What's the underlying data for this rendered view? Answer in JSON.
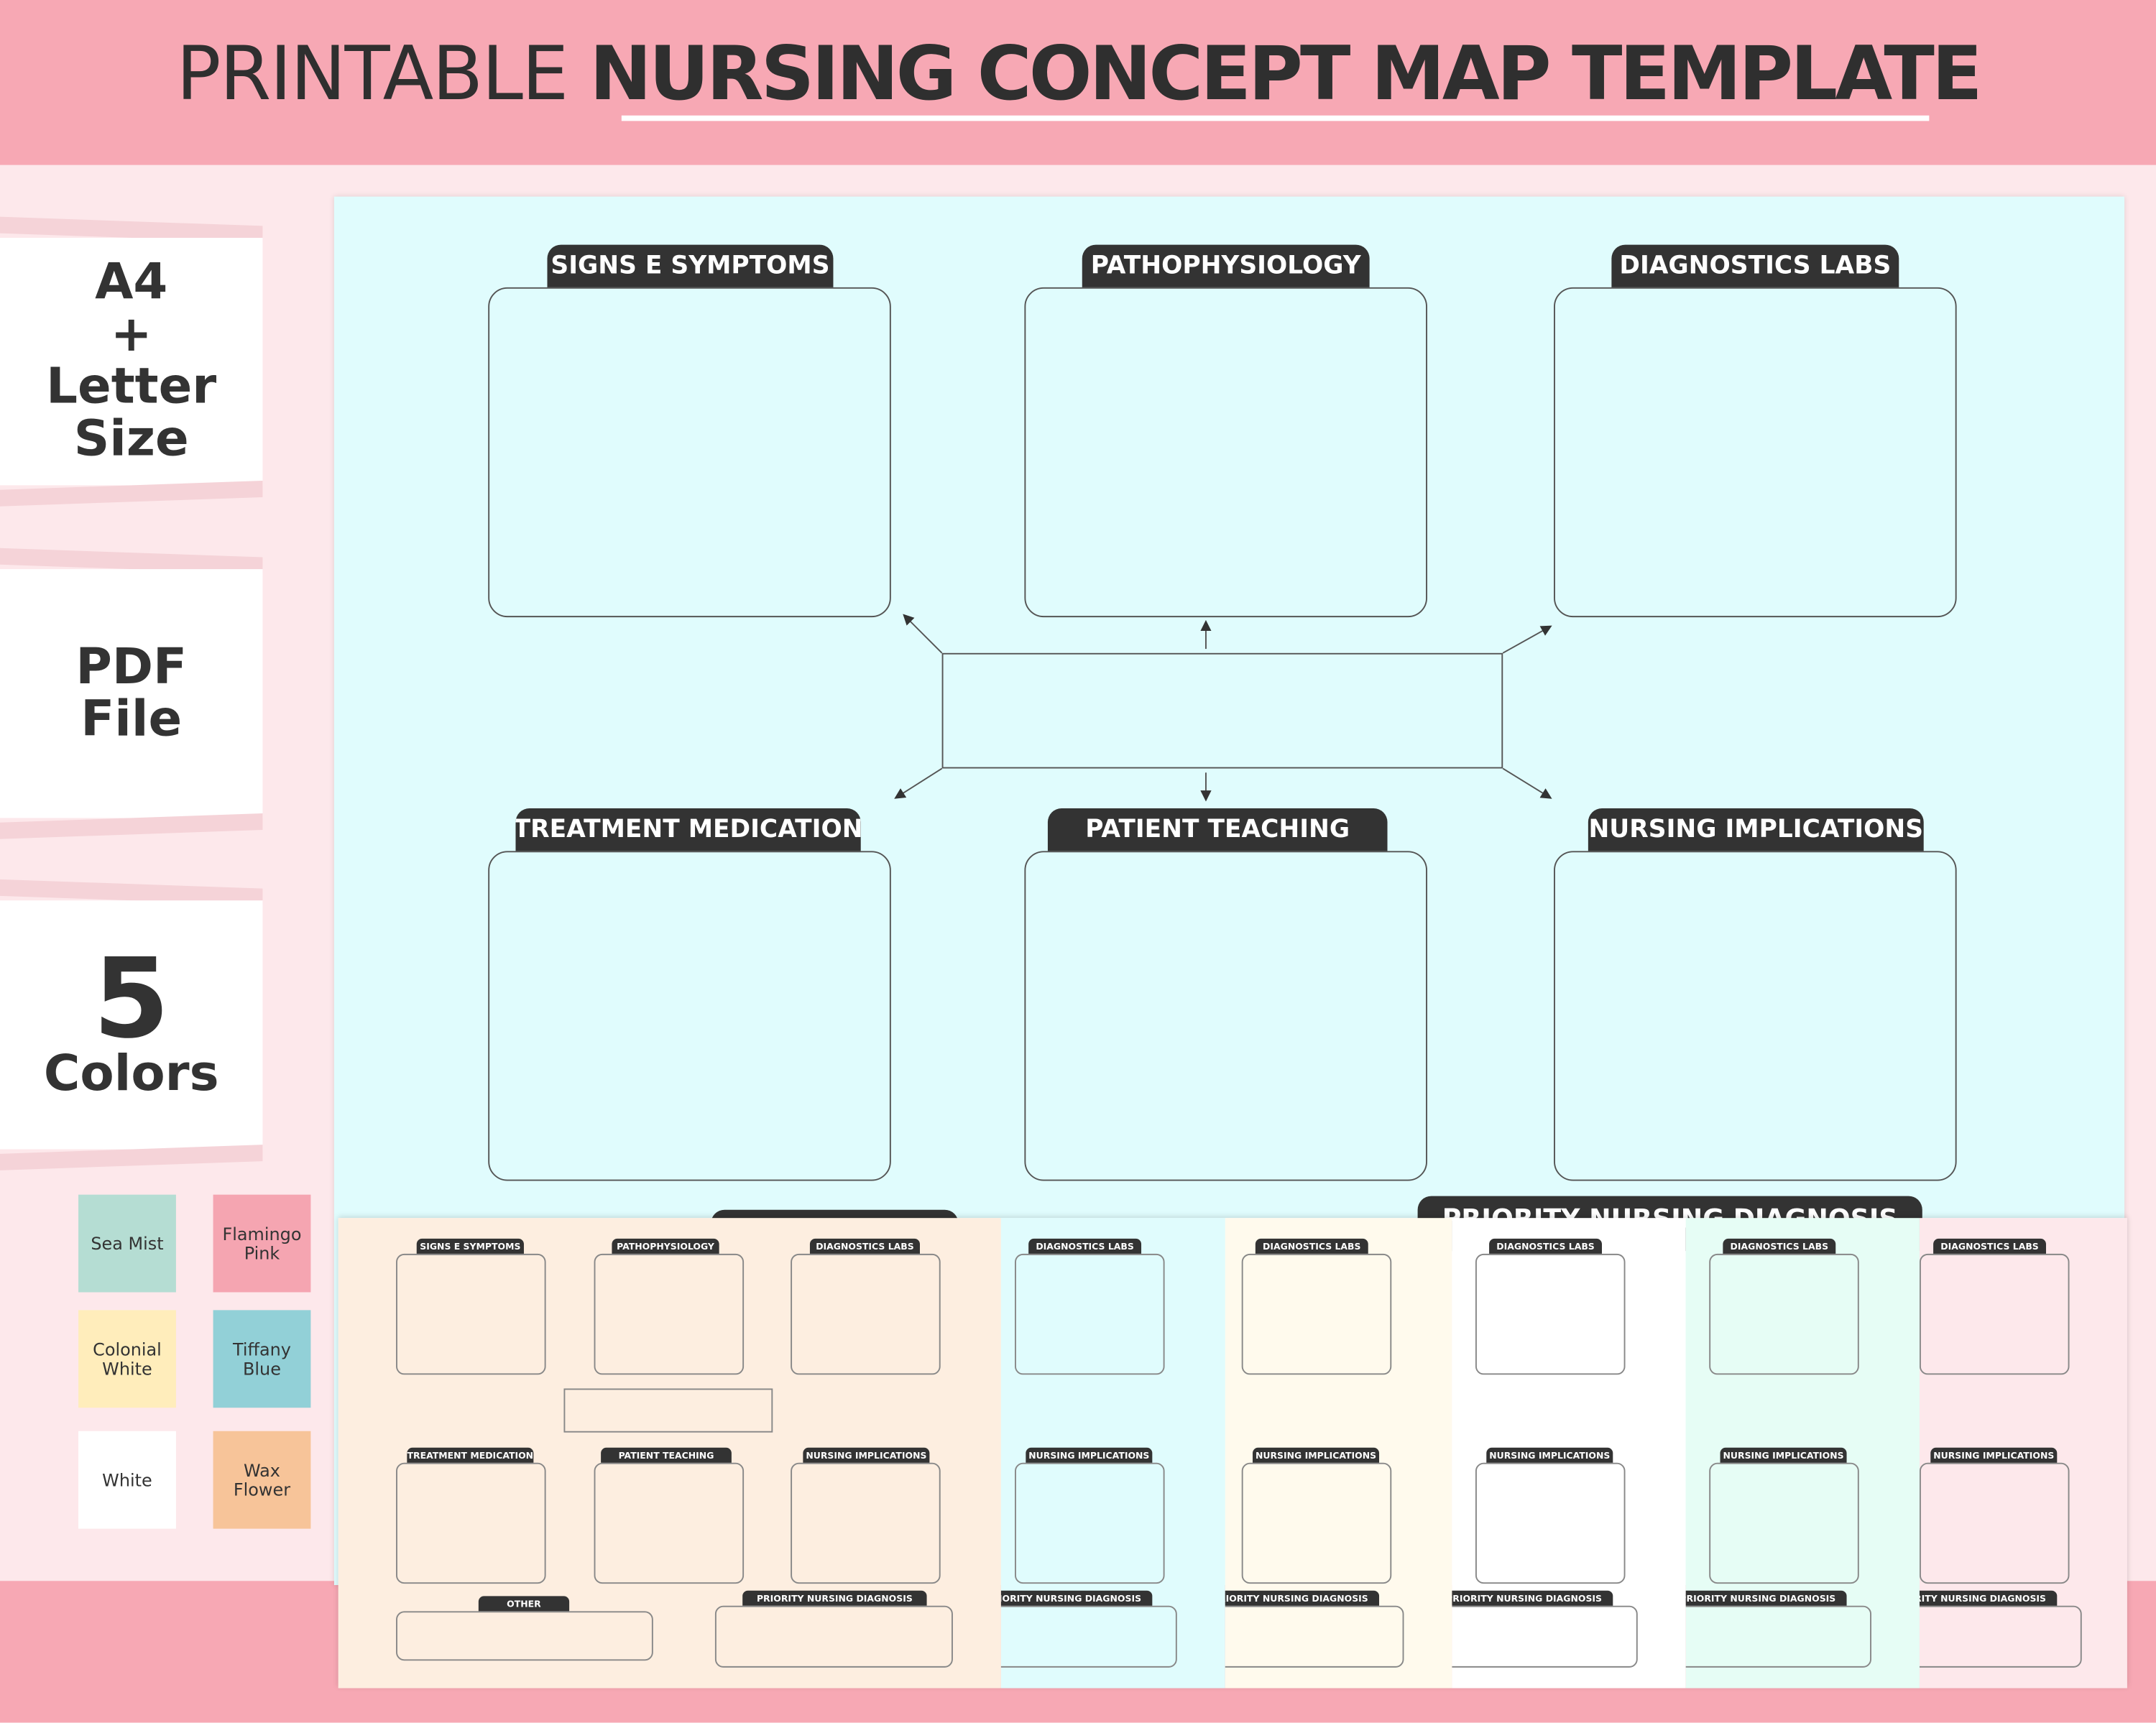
{
  "header": {
    "title_light": "PRINTABLE",
    "title_bold": "NURSING CONCEPT MAP TEMPLATE"
  },
  "features": [
    {
      "lines": [
        "A4",
        "+",
        "Letter",
        "Size"
      ]
    },
    {
      "lines": [
        "PDF",
        "File"
      ]
    },
    {
      "lines": [
        "5",
        "Colors"
      ]
    }
  ],
  "template": {
    "sections": [
      "SIGNS E SYMPTOMS",
      "PATHOPHYSIOLOGY",
      "DIAGNOSTICS LABS",
      "TREATMENT MEDICATION",
      "PATIENT TEACHING",
      "NURSING IMPLICATIONS"
    ],
    "other": "OTHER",
    "priority": "PRIORITY NURSING DIAGNOSIS",
    "background": "#e0fcfd"
  },
  "mini": {
    "sections": [
      "SIGNS E SYMPTOMS",
      "PATHOPHYSIOLOGY",
      "DIAGNOSTICS LABS",
      "TREATMENT MEDICATION",
      "PATIENT TEACHING",
      "NURSING IMPLICATIONS"
    ],
    "other": "OTHER",
    "priority": "PRIORITY NURSING DIAGNOSIS",
    "panel_colors": [
      "#fdeee0",
      "#e0fcfd",
      "#fffaed",
      "#ffffff",
      "#e6fdf5",
      "#fde8eb"
    ],
    "partial_labels": {
      "top": "DIAGNOSTICS LABS",
      "middle": "NURSING IMPLICATIONS",
      "bottom": "PRIORITY NURSING DIAGNOSIS"
    }
  },
  "swatches": [
    {
      "name": "Sea Mist",
      "color": "#b5ddd3"
    },
    {
      "name": "Flamingo Pink",
      "color": "#f5a5b1"
    },
    {
      "name": "Colonial White",
      "color": "#ffedbb"
    },
    {
      "name": "Tiffany Blue",
      "color": "#92d0d7"
    },
    {
      "name": "White",
      "color": "#ffffff"
    },
    {
      "name": "Wax Flower",
      "color": "#f7c499"
    }
  ]
}
